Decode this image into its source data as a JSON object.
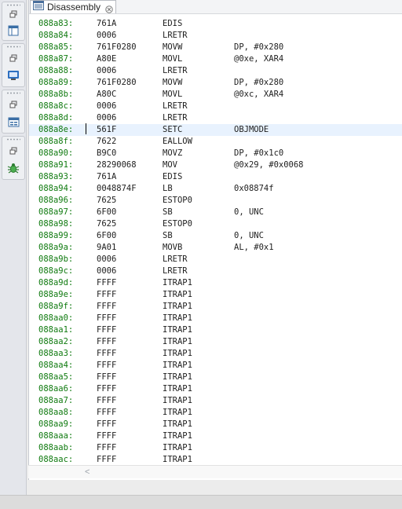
{
  "tab": {
    "title": "Disassembly",
    "icon": "disassembly-icon",
    "close_icon": "close-icon"
  },
  "toolbar": {
    "groups": [
      {
        "buttons": [
          "restore-icon",
          "view-layout-icon"
        ]
      },
      {
        "buttons": [
          "restore-icon",
          "console-icon"
        ]
      },
      {
        "buttons": [
          "restore-icon",
          "registers-icon"
        ]
      },
      {
        "buttons": [
          "restore-icon",
          "debug-bug-icon"
        ]
      }
    ]
  },
  "colors": {
    "address": "#0f7a0f",
    "current_line": "#e8f2fe",
    "accent_debug": "#4caf50"
  },
  "current_row": 9,
  "rows": [
    {
      "addr": "088a83:",
      "op": "761A",
      "mn": "EDIS",
      "args": ""
    },
    {
      "addr": "088a84:",
      "op": "0006",
      "mn": "LRETR",
      "args": ""
    },
    {
      "addr": "088a85:",
      "op": "761F0280",
      "mn": "MOVW",
      "args": "DP, #0x280"
    },
    {
      "addr": "088a87:",
      "op": "A80E",
      "mn": "MOVL",
      "args": "@0xe, XAR4"
    },
    {
      "addr": "088a88:",
      "op": "0006",
      "mn": "LRETR",
      "args": ""
    },
    {
      "addr": "088a89:",
      "op": "761F0280",
      "mn": "MOVW",
      "args": "DP, #0x280"
    },
    {
      "addr": "088a8b:",
      "op": "A80C",
      "mn": "MOVL",
      "args": "@0xc, XAR4"
    },
    {
      "addr": "088a8c:",
      "op": "0006",
      "mn": "LRETR",
      "args": ""
    },
    {
      "addr": "088a8d:",
      "op": "0006",
      "mn": "LRETR",
      "args": ""
    },
    {
      "addr": "088a8e:",
      "op": "561F",
      "mn": "SETC",
      "args": "OBJMODE"
    },
    {
      "addr": "088a8f:",
      "op": "7622",
      "mn": "EALLOW",
      "args": ""
    },
    {
      "addr": "088a90:",
      "op": "B9C0",
      "mn": "MOVZ",
      "args": "DP, #0x1c0"
    },
    {
      "addr": "088a91:",
      "op": "28290068",
      "mn": "MOV",
      "args": "@0x29, #0x0068"
    },
    {
      "addr": "088a93:",
      "op": "761A",
      "mn": "EDIS",
      "args": ""
    },
    {
      "addr": "088a94:",
      "op": "0048874F",
      "mn": "LB",
      "args": "0x08874f"
    },
    {
      "addr": "088a96:",
      "op": "7625",
      "mn": "ESTOP0",
      "args": ""
    },
    {
      "addr": "088a97:",
      "op": "6F00",
      "mn": "SB",
      "args": "0, UNC"
    },
    {
      "addr": "088a98:",
      "op": "7625",
      "mn": "ESTOP0",
      "args": ""
    },
    {
      "addr": "088a99:",
      "op": "6F00",
      "mn": "SB",
      "args": "0, UNC"
    },
    {
      "addr": "088a9a:",
      "op": "9A01",
      "mn": "MOVB",
      "args": "AL, #0x1"
    },
    {
      "addr": "088a9b:",
      "op": "0006",
      "mn": "LRETR",
      "args": ""
    },
    {
      "addr": "088a9c:",
      "op": "0006",
      "mn": "LRETR",
      "args": ""
    },
    {
      "addr": "088a9d:",
      "op": "FFFF",
      "mn": "ITRAP1",
      "args": ""
    },
    {
      "addr": "088a9e:",
      "op": "FFFF",
      "mn": "ITRAP1",
      "args": ""
    },
    {
      "addr": "088a9f:",
      "op": "FFFF",
      "mn": "ITRAP1",
      "args": ""
    },
    {
      "addr": "088aa0:",
      "op": "FFFF",
      "mn": "ITRAP1",
      "args": ""
    },
    {
      "addr": "088aa1:",
      "op": "FFFF",
      "mn": "ITRAP1",
      "args": ""
    },
    {
      "addr": "088aa2:",
      "op": "FFFF",
      "mn": "ITRAP1",
      "args": ""
    },
    {
      "addr": "088aa3:",
      "op": "FFFF",
      "mn": "ITRAP1",
      "args": ""
    },
    {
      "addr": "088aa4:",
      "op": "FFFF",
      "mn": "ITRAP1",
      "args": ""
    },
    {
      "addr": "088aa5:",
      "op": "FFFF",
      "mn": "ITRAP1",
      "args": ""
    },
    {
      "addr": "088aa6:",
      "op": "FFFF",
      "mn": "ITRAP1",
      "args": ""
    },
    {
      "addr": "088aa7:",
      "op": "FFFF",
      "mn": "ITRAP1",
      "args": ""
    },
    {
      "addr": "088aa8:",
      "op": "FFFF",
      "mn": "ITRAP1",
      "args": ""
    },
    {
      "addr": "088aa9:",
      "op": "FFFF",
      "mn": "ITRAP1",
      "args": ""
    },
    {
      "addr": "088aaa:",
      "op": "FFFF",
      "mn": "ITRAP1",
      "args": ""
    },
    {
      "addr": "088aab:",
      "op": "FFFF",
      "mn": "ITRAP1",
      "args": ""
    },
    {
      "addr": "088aac:",
      "op": "FFFF",
      "mn": "ITRAP1",
      "args": ""
    }
  ],
  "scrollbar": {
    "left_arrow": "chevron-left-icon"
  }
}
